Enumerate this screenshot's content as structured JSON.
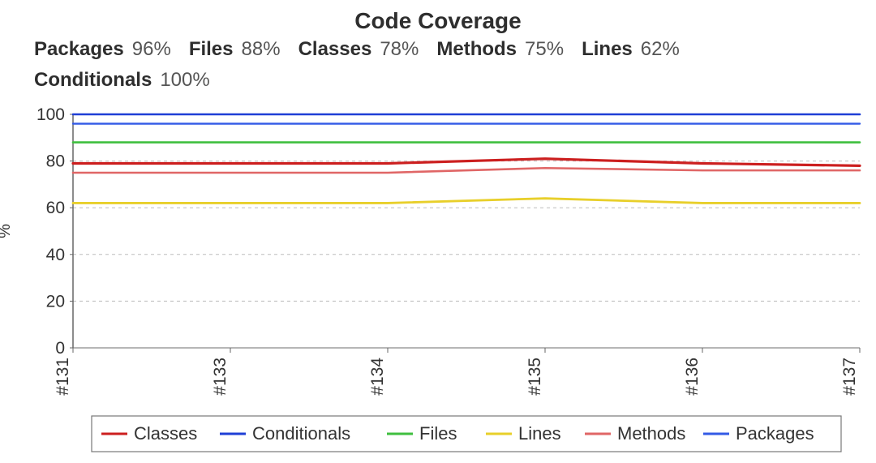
{
  "title": "Code Coverage",
  "summary": [
    {
      "label": "Packages",
      "value": "96%"
    },
    {
      "label": "Files",
      "value": "88%"
    },
    {
      "label": "Classes",
      "value": "78%"
    },
    {
      "label": "Methods",
      "value": "75%"
    },
    {
      "label": "Lines",
      "value": "62%"
    },
    {
      "label": "Conditionals",
      "value": "100%"
    }
  ],
  "chart_data": {
    "type": "line",
    "title": "Code Coverage",
    "xlabel": "",
    "ylabel": "%",
    "ylim": [
      0,
      100
    ],
    "yticks": [
      0,
      20,
      40,
      60,
      80,
      100
    ],
    "categories": [
      "#131",
      "#133",
      "#134",
      "#135",
      "#136",
      "#137"
    ],
    "series": [
      {
        "name": "Classes",
        "color": "#cc1f1f",
        "width": 3.2,
        "values": [
          79,
          79,
          79,
          81,
          79,
          78
        ]
      },
      {
        "name": "Conditionals",
        "color": "#1f3fd6",
        "width": 2.6,
        "values": [
          100,
          100,
          100,
          100,
          100,
          100
        ]
      },
      {
        "name": "Files",
        "color": "#3fbf3f",
        "width": 2.6,
        "values": [
          88,
          88,
          88,
          88,
          88,
          88
        ]
      },
      {
        "name": "Lines",
        "color": "#e8cf2a",
        "width": 2.8,
        "values": [
          62,
          62,
          62,
          64,
          62,
          62
        ]
      },
      {
        "name": "Methods",
        "color": "#e06666",
        "width": 2.6,
        "values": [
          75,
          75,
          75,
          77,
          76,
          76
        ]
      },
      {
        "name": "Packages",
        "color": "#335ae6",
        "width": 2.4,
        "values": [
          96,
          96,
          96,
          96,
          96,
          96
        ]
      }
    ],
    "legend_position": "bottom"
  }
}
